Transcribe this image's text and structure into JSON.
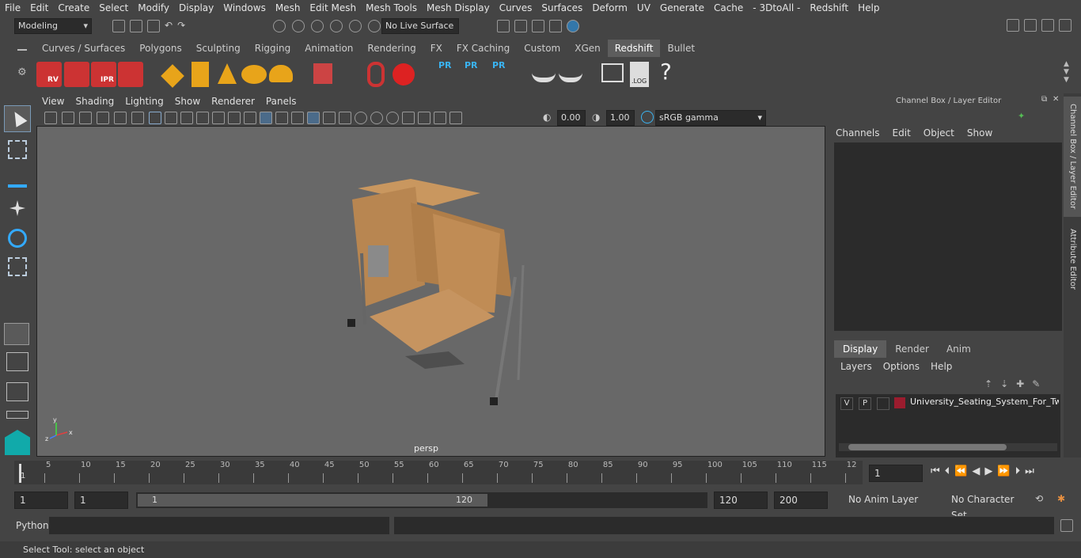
{
  "menubar": [
    "File",
    "Edit",
    "Create",
    "Select",
    "Modify",
    "Display",
    "Windows",
    "Mesh",
    "Edit Mesh",
    "Mesh Tools",
    "Mesh Display",
    "Curves",
    "Surfaces",
    "Deform",
    "UV",
    "Generate",
    "Cache",
    "- 3DtoAll -",
    "Redshift",
    "Help"
  ],
  "toolbar": {
    "mode": "Modeling",
    "live_surface": "No Live Surface"
  },
  "shelf_tabs": [
    "Curves / Surfaces",
    "Polygons",
    "Sculpting",
    "Rigging",
    "Animation",
    "Rendering",
    "FX",
    "FX Caching",
    "Custom",
    "XGen",
    "Redshift",
    "Bullet"
  ],
  "shelf_active": "Redshift",
  "shelf_labels": {
    "rv": "RV",
    "ipr": "IPR",
    "pr1": "PR",
    "pr2": "PR",
    "pr3": "PR",
    "log": ".LOG",
    "help": "?"
  },
  "viewport_menu": [
    "View",
    "Shading",
    "Lighting",
    "Show",
    "Renderer",
    "Panels"
  ],
  "viewport": {
    "exposure": "0.00",
    "gamma": "1.00",
    "colorspace": "sRGB gamma",
    "camera": "persp",
    "axis_x": "x",
    "axis_y": "y",
    "axis_z": "z"
  },
  "channelbox": {
    "title": "Channel Box / Layer Editor",
    "menu": [
      "Channels",
      "Edit",
      "Object",
      "Show"
    ]
  },
  "layer_tabs": [
    "Display",
    "Render",
    "Anim"
  ],
  "layer_menu": [
    "Layers",
    "Options",
    "Help"
  ],
  "layer": {
    "v": "V",
    "p": "P",
    "name": "University_Seating_System_For_Two_",
    "color": "#9b1c2e"
  },
  "side_tabs": [
    "Channel Box / Layer Editor",
    "Attribute Editor"
  ],
  "timeline": {
    "ticks": [
      "5",
      "10",
      "15",
      "20",
      "25",
      "30",
      "35",
      "40",
      "45",
      "50",
      "55",
      "60",
      "65",
      "70",
      "75",
      "80",
      "85",
      "90",
      "95",
      "100",
      "105",
      "110",
      "115",
      "12"
    ],
    "current": "1",
    "frame_field": "1"
  },
  "range": {
    "start": "1",
    "start2": "1",
    "slider_start": "1",
    "slider_end": "120",
    "end": "120",
    "end2": "200",
    "anim_layer": "No Anim Layer",
    "char_set": "No Character Set"
  },
  "python": {
    "label": "Python"
  },
  "status": "Select Tool: select an object"
}
